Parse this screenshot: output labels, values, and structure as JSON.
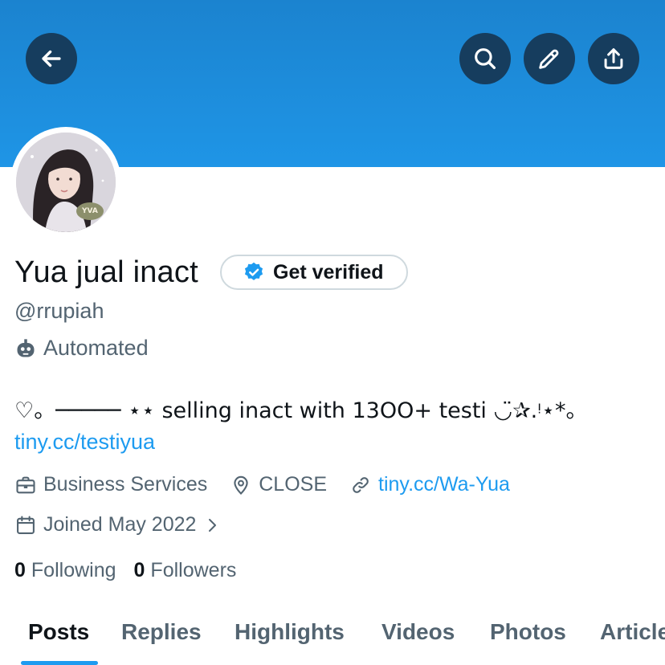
{
  "header": {
    "back_icon": "arrow-left-icon",
    "search_icon": "search-icon",
    "edit_icon": "pencil-icon",
    "share_icon": "share-upload-icon",
    "banner_color": "#1f95e6",
    "button_color": "#163d5e"
  },
  "profile": {
    "avatar_badge": "YVA",
    "display_name": "Yua jual inact",
    "verify_label": "Get verified",
    "handle": "@rrupiah",
    "automated_label": "Automated",
    "bio": "♡。───── ⋆⋆ selling inact with 13OO+ testi ◡̈✰.ᵎ⋆*。",
    "bio_link": "tiny.cc/testiyua",
    "category": "Business Services",
    "location": "CLOSE",
    "website": "tiny.cc/Wa-Yua",
    "joined": "Joined May 2022",
    "following_count": "0",
    "following_label": "Following",
    "followers_count": "0",
    "followers_label": "Followers"
  },
  "tabs": [
    {
      "label": "Posts",
      "active": true
    },
    {
      "label": "Replies",
      "active": false
    },
    {
      "label": "Highlights",
      "active": false
    },
    {
      "label": "Videos",
      "active": false
    },
    {
      "label": "Photos",
      "active": false
    },
    {
      "label": "Articles",
      "active": false
    }
  ],
  "colors": {
    "accent": "#1d9bf0",
    "text_primary": "#0f1419",
    "text_secondary": "#536471"
  }
}
